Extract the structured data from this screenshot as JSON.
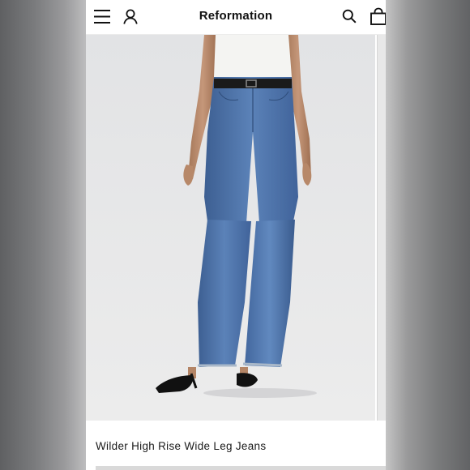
{
  "header": {
    "brand": "Reformation",
    "icons": [
      "menu-icon",
      "account-icon",
      "search-icon",
      "bag-icon"
    ]
  },
  "product": {
    "title": "Wilder High Rise Wide Leg Jeans",
    "image_subject": "model wearing medium-wash high rise wide leg jeans with black belt and black kitten-heel mules"
  },
  "colors": {
    "page_bg": "#ffffff",
    "text": "#111111",
    "denim": "#4a6fa5",
    "photo_bg": "#e6e6e6"
  }
}
